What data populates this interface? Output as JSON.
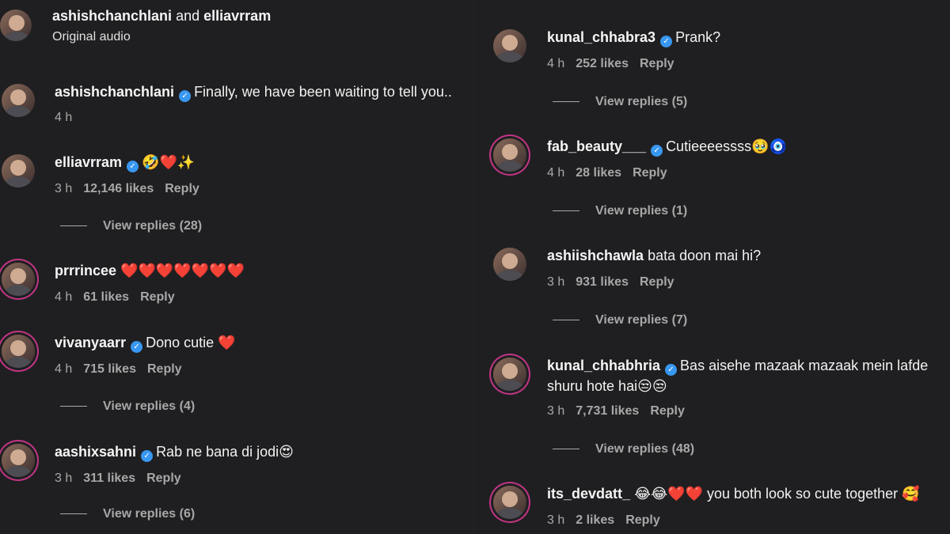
{
  "left": {
    "header": {
      "title_a": "ashishchanchlani",
      "title_and": "and",
      "title_b": "elliavrram",
      "subtitle": "Original audio"
    },
    "comments": [
      {
        "user": "ashishchanchlani",
        "verified": true,
        "text": "Finally, we have been waiting to tell you..",
        "time": "4 h",
        "likes": "",
        "reply": "",
        "replies": ""
      },
      {
        "user": "elliavrram",
        "verified": true,
        "text": "🤣❤️✨",
        "time": "3 h",
        "likes": "12,146 likes",
        "reply": "Reply",
        "replies": "View replies (28)"
      },
      {
        "user": "prrrincee",
        "verified": false,
        "text": "❤️❤️❤️❤️❤️❤️❤️",
        "time": "4 h",
        "likes": "61 likes",
        "reply": "Reply",
        "replies": ""
      },
      {
        "user": "vivanyaarr",
        "verified": true,
        "text": "Dono cutie ❤️",
        "time": "4 h",
        "likes": "715 likes",
        "reply": "Reply",
        "replies": "View replies (4)"
      },
      {
        "user": "aashixsahni",
        "verified": true,
        "text": "Rab ne bana di jodi😍",
        "time": "3 h",
        "likes": "311 likes",
        "reply": "Reply",
        "replies": "View replies (6)"
      }
    ]
  },
  "right": {
    "comments": [
      {
        "user": "kunal_chhabra3",
        "verified": true,
        "text": "Prank?",
        "time": "4 h",
        "likes": "252 likes",
        "reply": "Reply",
        "replies": "View replies (5)"
      },
      {
        "user": "fab_beauty___",
        "verified": true,
        "text": "Cutieeeessss🥹🧿",
        "time": "4 h",
        "likes": "28 likes",
        "reply": "Reply",
        "replies": "View replies (1)"
      },
      {
        "user": "ashiishchawla",
        "verified": false,
        "text": "bata doon mai hi?",
        "time": "3 h",
        "likes": "931 likes",
        "reply": "Reply",
        "replies": "View replies (7)"
      },
      {
        "user": "kunal_chhabhria",
        "verified": true,
        "text": "Bas aisehe mazaak mazaak mein lafde",
        "text2": "shuru hote hai😒😒",
        "time": "3 h",
        "likes": "7,731 likes",
        "reply": "Reply",
        "replies": "View replies (48)"
      },
      {
        "user": "its_devdatt_",
        "verified": false,
        "text": "😂😂❤️❤️ you both look so cute together 🥰",
        "time": "3 h",
        "likes": "2 likes",
        "reply": "Reply",
        "replies": ""
      }
    ]
  },
  "colors": {
    "background": "#1f1f21",
    "verified": "#3897f0",
    "muted": "#a8a8a8",
    "story_ring": "#c13584"
  }
}
